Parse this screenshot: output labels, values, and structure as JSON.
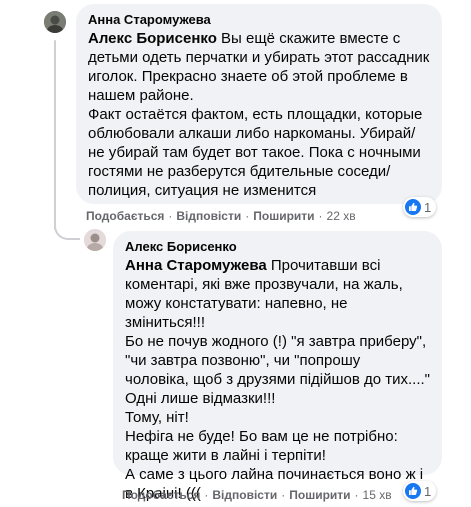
{
  "comments": [
    {
      "author": "Анна Старомужева",
      "mention": "Алекс Борисенко",
      "text": " Вы ещё скажите вместе с\nдетьми одеть перчатки и убирать этот рассадник\nиголок. Прекрасно знаете об этой проблеме в\nнашем районе.\nФакт остаётся фактом, есть площадки, которые\nоблюбовали алкаши либо наркоманы. Убирай/\nне убирай там будет вот такое. Пока с ночными\nгостями не разберутся бдительные соседи/\nполиция, ситуация не изменится",
      "actions": {
        "like": "Подобається",
        "reply": "Відповісти",
        "share": "Поширити",
        "time": "22 хв"
      },
      "reaction_count": "1"
    },
    {
      "author": "Алекс Борисенко",
      "mention": "Анна Старомужева",
      "text": " Прочитавши всі\nкоментарі, які вже прозвучали, на жаль,\nможу констатувати: напевно, не зміниться!!!\nБо не почув жодного (!) \"я завтра приберу\",\n\"чи завтра позвоню\", чи \"попрошу\nчоловіка, щоб з друзями підійшов до тих....\"\nОдні лише відмазки!!!\nТому, ніт!\nНефіга не буде! Бо вам це не потрібно:\nкраще жити в лайні і терпіти!\nА саме з цього лайна починається воно ж і\nв Краіні! (((",
      "actions": {
        "like": "Подобається",
        "reply": "Відповісти",
        "share": "Поширити",
        "time": "15 хв"
      },
      "reaction_count": "1"
    }
  ],
  "separator": "·",
  "colors": {
    "bubble": "#f0f2f5",
    "meta": "#65676b",
    "like": "#1877f2",
    "thread": "#ced0d4"
  },
  "icons": {
    "reaction": "like-icon"
  }
}
